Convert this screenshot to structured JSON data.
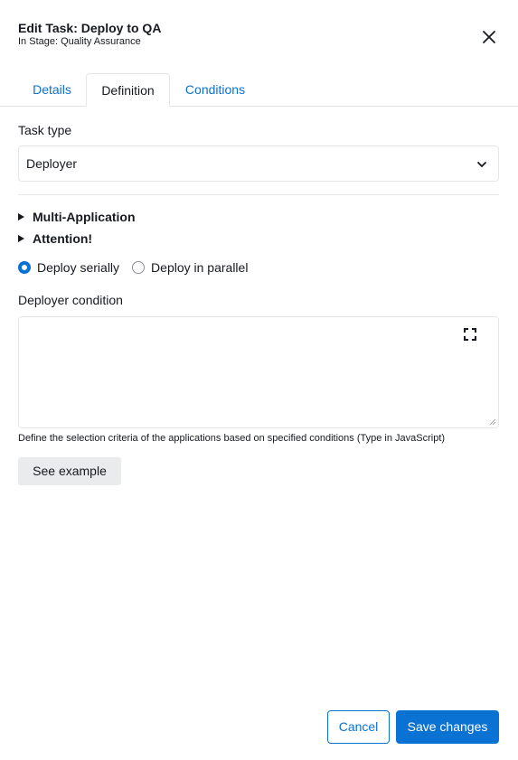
{
  "header": {
    "title": "Edit Task: Deploy to QA",
    "subtitle": "In Stage: Quality Assurance",
    "close_icon": "close-icon"
  },
  "tabs": [
    {
      "label": "Details",
      "active": false
    },
    {
      "label": "Definition",
      "active": true
    },
    {
      "label": "Conditions",
      "active": false
    }
  ],
  "task_type": {
    "label": "Task type",
    "selected": "Deployer",
    "icon": "chevron-down-icon"
  },
  "expanders": [
    {
      "label": "Multi-Application",
      "expanded": false
    },
    {
      "label": "Attention!",
      "expanded": false
    }
  ],
  "deploy_mode": {
    "options": [
      {
        "label": "Deploy serially",
        "selected": true
      },
      {
        "label": "Deploy in parallel",
        "selected": false
      }
    ]
  },
  "deployer_condition": {
    "label": "Deployer condition",
    "value": "",
    "hint": "Define the selection criteria of the applications based on specified conditions (Type in JavaScript)",
    "expand_icon": "fullscreen-icon"
  },
  "see_example_label": "See example",
  "footer": {
    "cancel_label": "Cancel",
    "save_label": "Save changes"
  },
  "colors": {
    "accent": "#0972d3",
    "border": "#e4e7ea",
    "secondary_button_bg": "#e9ebed",
    "text": "#16191f"
  }
}
